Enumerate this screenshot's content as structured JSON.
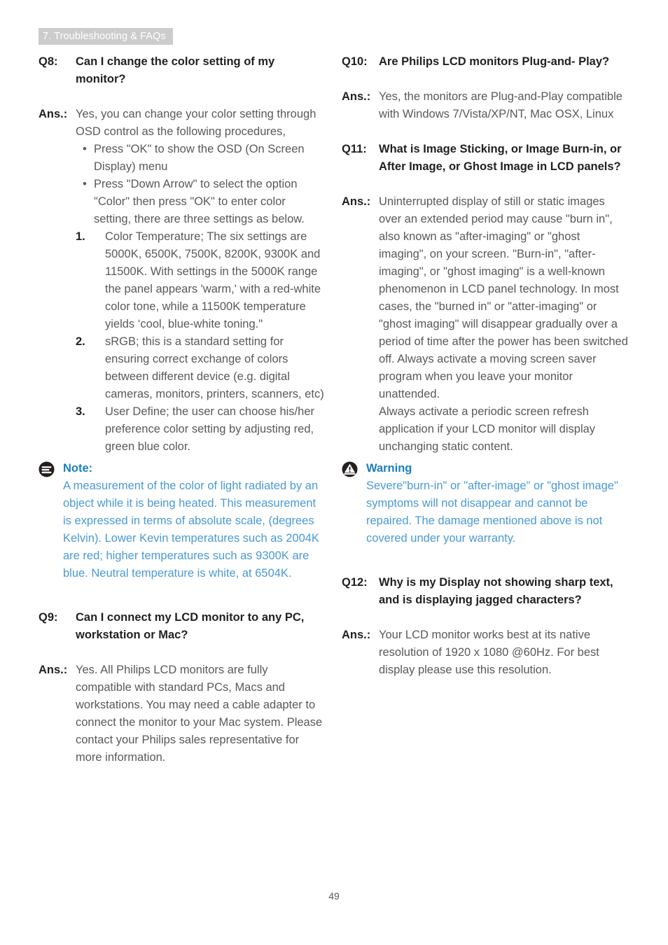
{
  "header": {
    "chapter_label": "7. Troubleshooting & FAQs"
  },
  "footer": {
    "page_number": "49"
  },
  "colors": {
    "banner_bg": "#cccccc",
    "banner_text": "#ffffff",
    "body_text": "#58595b",
    "heading_text": "#231f20",
    "note_heading": "#1a7fc1",
    "note_body": "#4a9ad4"
  },
  "labels": {
    "q8": "Q8:",
    "q9": "Q9:",
    "q10": "Q10:",
    "q11": "Q11:",
    "q12": "Q12:",
    "ans": "Ans.:"
  },
  "left_column": {
    "q8": {
      "question": "Can I change the color setting of my monitor?",
      "answer_intro": "Yes, you can change your color setting through OSD control as the following procedures,",
      "bullets": [
        "Press \"OK\" to show the OSD (On Screen Display) menu",
        "Press \"Down Arrow\" to select the option \"Color\" then press \"OK\" to enter color setting, there are three settings as below."
      ],
      "numbered": [
        {
          "num": "1.",
          "text": "Color Temperature; The six settings are 5000K, 6500K, 7500K, 8200K, 9300K and 11500K. With settings in the 5000K range the panel appears 'warm,' with a red-white color tone, while a 11500K temperature yields ‘cool, blue-white toning.\""
        },
        {
          "num": "2.",
          "text": "sRGB; this is a standard setting for ensuring correct exchange of colors between different device (e.g. digital cameras, monitors, printers, scanners, etc)"
        },
        {
          "num": "3.",
          "text": "User Define; the user can choose his/her preference color setting by adjusting red, green blue color."
        }
      ],
      "note": {
        "icon": "note-icon",
        "heading": "Note:",
        "body": "A measurement of the color of light radiated by an object while it is being heated. This measurement is expressed in terms of absolute scale, (degrees Kelvin). Lower Kevin temperatures such as 2004K are red; higher temperatures such as 9300K are blue. Neutral temperature is white, at 6504K."
      }
    },
    "q9": {
      "question": "Can I connect my LCD monitor to any PC, workstation or Mac?",
      "answer": "Yes. All Philips LCD monitors are fully compatible with standard PCs, Macs and workstations. You may need a cable adapter to connect the monitor to your Mac system. Please contact your Philips sales representative for more information."
    }
  },
  "right_column": {
    "q10": {
      "question": "Are Philips LCD monitors Plug-and- Play?",
      "answer": "Yes, the monitors are Plug-and-Play compatible with Windows 7/Vista/XP/NT, Mac OSX, Linux"
    },
    "q11": {
      "question": "What is Image Sticking, or Image Burn-in, or After Image, or Ghost Image in LCD panels?",
      "answer_p1": "Uninterrupted display of still or static images over an extended period may cause \"burn in\", also known as \"after-imaging\" or \"ghost imaging\", on your screen. \"Burn-in\", \"after-imaging\", or \"ghost imaging\" is a well-known phenomenon in LCD panel technology. In most cases, the \"burned in\" or \"atter-imaging\" or \"ghost imaging\" will disappear gradually over a period of time after the power has been switched off. Always activate a moving screen saver program when you leave your monitor unattended.",
      "answer_p2": "Always activate a periodic screen refresh application if your LCD monitor will display unchanging static content.",
      "warning": {
        "icon": "warning-icon",
        "heading": "Warning",
        "body": "Severe\"burn-in\" or \"after-image\" or \"ghost image\" symptoms will not disappear and cannot be repaired. The damage mentioned above is not covered under your warranty."
      }
    },
    "q12": {
      "question": "Why is my Display not showing sharp text, and is displaying jagged characters?",
      "answer": "Your LCD monitor works best at its native resolution of 1920 x 1080 @60Hz. For best display please use this resolution."
    }
  }
}
